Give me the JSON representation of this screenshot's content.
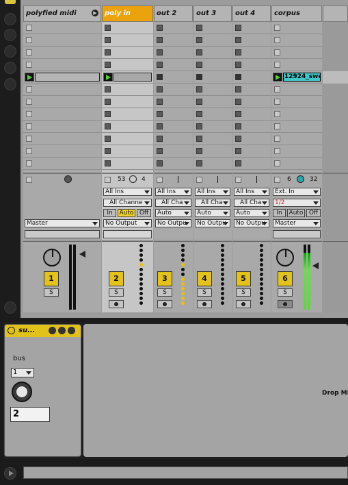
{
  "tracks": [
    {
      "name": "polyfied midi",
      "selected": false
    },
    {
      "name": "poly in",
      "selected": true
    },
    {
      "name": "out 2",
      "selected": false
    },
    {
      "name": "out 3",
      "selected": false
    },
    {
      "name": "out 4",
      "selected": false
    },
    {
      "name": "corpus",
      "selected": false
    }
  ],
  "clips": {
    "corpus_clip": "12924_swee"
  },
  "stop_row": {
    "poly_left": "53",
    "poly_right": "4",
    "corpus_left": "6",
    "corpus_right": "32"
  },
  "io": {
    "master_out": "Master",
    "poly_in": {
      "input": "All Ins",
      "channel": "All Channe",
      "mon_in": "In",
      "mon_auto": "Auto",
      "mon_off": "Off",
      "output": "No Output"
    },
    "out2": {
      "input": "All Ins",
      "channel": "All Cha",
      "mon": "Auto",
      "output": "No Outpu"
    },
    "out3": {
      "input": "All Ins",
      "channel": "All Cha",
      "mon": "Auto",
      "output": "No Outpu"
    },
    "out4": {
      "input": "All Ins",
      "channel": "All Cha",
      "mon": "Auto",
      "output": "No Outpu"
    },
    "corpus": {
      "input": "Ext. In",
      "channel": "1/2",
      "mon_in": "In",
      "mon_auto": "Auto",
      "mon_off": "Off",
      "output": "Master"
    }
  },
  "mixer": {
    "numbers": [
      "1",
      "2",
      "3",
      "4",
      "5",
      "6"
    ],
    "solo_label": "S"
  },
  "device": {
    "title": "su...",
    "param_label": "bus",
    "select_value": "1",
    "number_value": "2",
    "drop_text": "Drop MI"
  },
  "icons": [
    "clip-view-icon",
    "power-icon",
    "record-icon",
    "play-icon"
  ],
  "colors": {
    "selected_track": "#eaa20d",
    "clip": "#3fc7c9",
    "track_number": "#e3c31a",
    "meter_green": "#5fe83a"
  }
}
